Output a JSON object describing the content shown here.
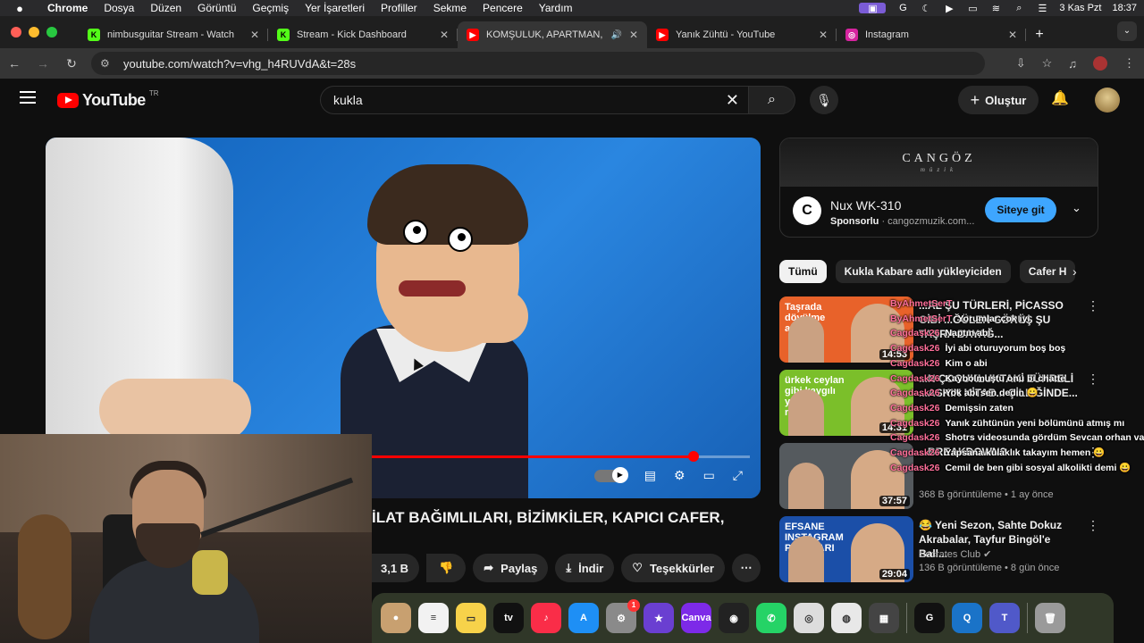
{
  "menubar": {
    "app_name": "Chrome",
    "items": [
      "Dosya",
      "Düzen",
      "Görüntü",
      "Geçmiş",
      "Yer İşaretleri",
      "Profiller",
      "Sekme",
      "Pencere",
      "Yardım"
    ],
    "date": "3 Kas Pzt",
    "time": "18:37"
  },
  "tabs": [
    {
      "title": "nimbusguitar Stream - Watch",
      "favicon": "kick-icon",
      "color": "#53fc18",
      "glyph": "K"
    },
    {
      "title": "Stream - Kick Dashboard",
      "favicon": "kick-icon",
      "color": "#53fc18",
      "glyph": "K"
    },
    {
      "title": "KOMŞULUK, APARTMAN, ",
      "favicon": "youtube-icon",
      "color": "#ff0000",
      "glyph": "▶",
      "active": true
    },
    {
      "title": "Yanık Zühtü - YouTube",
      "favicon": "youtube-icon",
      "color": "#ff0000",
      "glyph": "▶"
    },
    {
      "title": "Instagram",
      "favicon": "instagram-icon",
      "color": "#d6249f",
      "glyph": "◎"
    }
  ],
  "url": "youtube.com/watch?v=vhg_h4RUVdA&t=28s",
  "youtube": {
    "logo_text": "YouTube",
    "country_code": "TR",
    "search_query": "kukla",
    "create_label": "Oluştur"
  },
  "player": {
    "progress": 0.92
  },
  "video": {
    "title_visible": "İLAT BAĞIMLILARI, BİZİMKİLER, KAPICI CAFER,",
    "like_count": "3,1 B",
    "share_label": "Paylaş",
    "download_label": "İndir",
    "thanks_label": "Teşekkürler"
  },
  "ad": {
    "brand": "CANGÖZ",
    "brand_sub": "müzik",
    "product": "Nux WK-310",
    "sponsored": "Sponsorlu",
    "domain": "cangozmuzik.com...",
    "cta": "Siteye git"
  },
  "chips": [
    "Tümü",
    "Kukla Kabare adlı yükleyiciden",
    "Cafer H"
  ],
  "recommendations": [
    {
      "title": "...AL ŞU TÜRLERİ, PİCASSO GİBİ ...ĞÜLEN GÖRÜŞ ŞU TAŞRA DAYAĞ...",
      "duration": "14:53",
      "channel": "",
      "meta": "",
      "thumb_color": "#e8622a",
      "thumb_text": "Taşrada dövülme adabı!"
    },
    {
      "title": "...N ÇOCUKLUKTAKİ ZÜHRELİ ...ASKIN KİTAB... ÇİLLİĞİNDE...",
      "duration": "14:31",
      "channel": "",
      "meta": "",
      "thumb_color": "#7bbf2a",
      "thumb_text": "ürkek ceylan gibi kaygılı yaşam rehberi!"
    },
    {
      "title": "...BREAKDOWN?",
      "duration": "37:57",
      "channel": "",
      "meta": "368 B görüntüleme • 1 ay önce",
      "thumb_color": "#555a5e",
      "thumb_text": ""
    },
    {
      "title": "😂 Yeni Sezon, Sahte Dokuz Akrabalar, Tayfur Bingöl'e Ball...",
      "duration": "29:04",
      "channel": "Socrates Club ✔",
      "meta": "136 B görüntüleme • 8 gün önce",
      "thumb_color": "#1b4fa8",
      "thumb_text": "EFSANE INSTAGRAM POSTLARI"
    }
  ],
  "chat": [
    {
      "user": "ByAhmetSerT",
      "text": ""
    },
    {
      "user": "ByAhmetSerT",
      "text": "Yorumlar çok iyi"
    },
    {
      "user": "Cagdask26",
      "text": "Naptın abi"
    },
    {
      "user": "Cagdask26",
      "text": "İyi abi oturuyorum boş boş"
    },
    {
      "user": "Cagdask26",
      "text": "Kim o abi"
    },
    {
      "user": "Cagdask26",
      "text": "Kaybolmuştu onu bi chatte"
    },
    {
      "user": "Cagdask26",
      "text": "Yok abi sen dedin 😀"
    },
    {
      "user": "Cagdask26",
      "text": "Demişsin zaten"
    },
    {
      "user": "Cagdask26",
      "text": "Yanık zühtünün yeni bölümünü atmış mı"
    },
    {
      "user": "Cagdask26",
      "text": "Shotrs videosunda gördüm Sevcan orhan vardı"
    },
    {
      "user": "Cagdask26",
      "text": "Yapsana kulaklık takayım hemen 😀"
    },
    {
      "user": "Cagdask26",
      "text": "Cemil de ben gibi sosyal alkolikti demi 😀"
    }
  ],
  "dock": [
    {
      "name": "contacts-app",
      "color": "#c8a070",
      "glyph": "●"
    },
    {
      "name": "reminders-app",
      "color": "#f2f2f2",
      "glyph": "≡"
    },
    {
      "name": "notes-app",
      "color": "#f7d24a",
      "glyph": "▭"
    },
    {
      "name": "appletv-app",
      "color": "#111",
      "glyph": "tv"
    },
    {
      "name": "music-app",
      "color": "#fa2d48",
      "glyph": "♪"
    },
    {
      "name": "appstore-app",
      "color": "#1e8ff5",
      "glyph": "A"
    },
    {
      "name": "settings-app",
      "color": "#8a8a8a",
      "glyph": "⚙",
      "badge": "1"
    },
    {
      "name": "imovie-app",
      "color": "#6a3fd1",
      "glyph": "★"
    },
    {
      "name": "canva-app",
      "color": "#7d2ae8",
      "glyph": "Canva"
    },
    {
      "name": "obs-app",
      "color": "#222",
      "glyph": "◉"
    },
    {
      "name": "whatsapp-app",
      "color": "#25d366",
      "glyph": "✆"
    },
    {
      "name": "diskutility-app",
      "color": "#ddd",
      "glyph": "◎"
    },
    {
      "name": "chrome-app",
      "color": "#e8e8e8",
      "glyph": "◍"
    },
    {
      "name": "calculator-app",
      "color": "#444",
      "glyph": "▦"
    },
    {
      "name": "capcut-app",
      "color": "#111",
      "glyph": "G"
    },
    {
      "name": "quicktime-app",
      "color": "#1a73c8",
      "glyph": "Q"
    },
    {
      "name": "teams-app",
      "color": "#5059c9",
      "glyph": "T"
    },
    {
      "name": "trash-app",
      "color": "#9a9a9a",
      "glyph": "🗑"
    }
  ]
}
